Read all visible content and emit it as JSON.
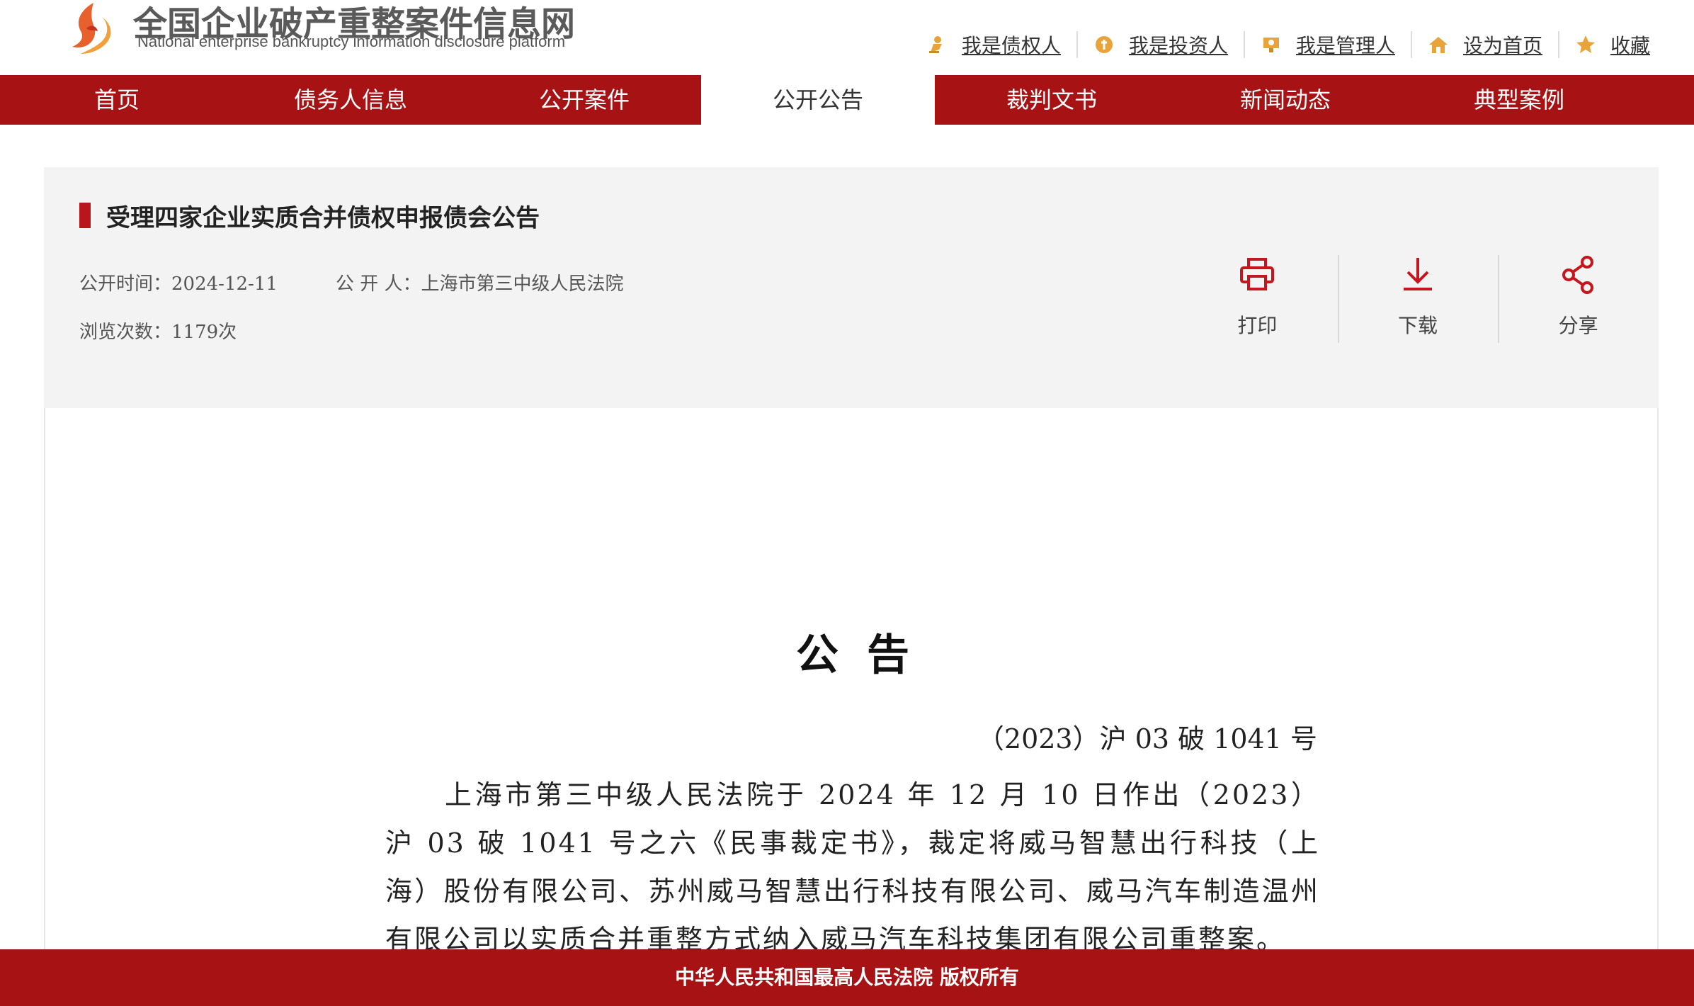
{
  "header": {
    "site_title": "全国企业破产重整案件信息网",
    "site_subtitle": "National enterprise bankruptcy  information disclosure platform",
    "quick_links": [
      {
        "label": "我是债权人",
        "icon": "creditor-icon"
      },
      {
        "label": "我是投资人",
        "icon": "investor-icon"
      },
      {
        "label": "我是管理人",
        "icon": "manager-icon"
      },
      {
        "label": "设为首页",
        "icon": "home-icon"
      },
      {
        "label": "收藏",
        "icon": "star-icon"
      }
    ]
  },
  "nav": {
    "items": [
      "首页",
      "债务人信息",
      "公开案件",
      "公开公告",
      "裁判文书",
      "新闻动态",
      "典型案例"
    ],
    "active_index": 3
  },
  "notice": {
    "title": "受理四家企业实质合并债权申报债会公告",
    "publish_time_label": "公开时间：",
    "publish_time": "2024-12-11",
    "publisher_label": "公 开 人：",
    "publisher": "上海市第三中级人民法院",
    "views_label": "浏览次数：",
    "views": "1179次",
    "tools": [
      {
        "label": "打印",
        "icon": "print-icon"
      },
      {
        "label": "下载",
        "icon": "download-icon"
      },
      {
        "label": "分享",
        "icon": "share-icon"
      }
    ]
  },
  "document": {
    "heading": "公告",
    "case_number": "（2023）沪 03 破 1041 号",
    "body": "上海市第三中级人民法院于 2024 年 12 月 10 日作出（2023）沪 03 破 1041 号之六《民事裁定书》，裁定将威马智慧出行科技（上海）股份有限公司、苏州威马智慧出行科技有限公司、威马汽车制造温州有限公司以实质合并重整方式纳入威马汽车科技集团有限公司重整案。"
  },
  "footer": {
    "copyright": "中华人民共和国最高人民法院 版权所有"
  },
  "colors": {
    "brand_red": "#a71314",
    "panel_bg": "#f3f3f3",
    "accent_red": "#b8161b"
  }
}
